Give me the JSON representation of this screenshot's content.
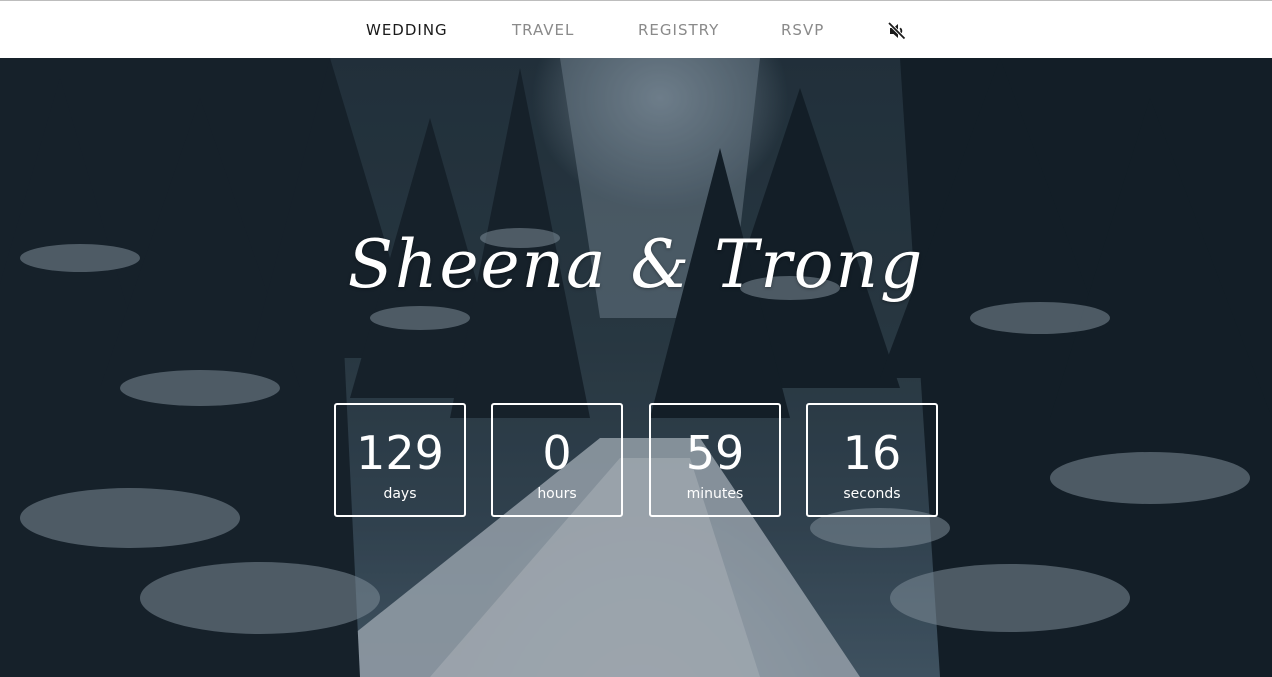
{
  "nav": {
    "items": [
      {
        "label": "WEDDING",
        "active": true
      },
      {
        "label": "TRAVEL",
        "active": false
      },
      {
        "label": "REGISTRY",
        "active": false
      },
      {
        "label": "RSVP",
        "active": false
      }
    ],
    "mute_icon": "speaker-muted-icon"
  },
  "hero": {
    "title": "Sheena & Trong",
    "countdown": [
      {
        "value": "129",
        "label": "days"
      },
      {
        "value": "0",
        "label": "hours"
      },
      {
        "value": "59",
        "label": "minutes"
      },
      {
        "value": "16",
        "label": "seconds"
      }
    ]
  },
  "colors": {
    "nav_background": "#ffffff",
    "nav_active": "#1a1a1a",
    "nav_inactive": "#8a8a8a",
    "hero_text": "#ffffff"
  }
}
